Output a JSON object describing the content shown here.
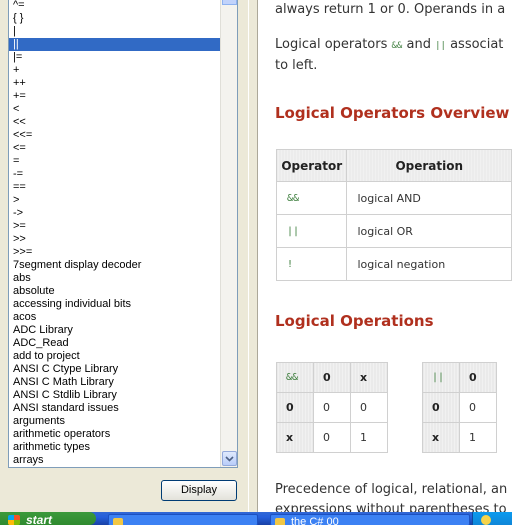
{
  "index": {
    "items": [
      "^=",
      "{ }",
      "|",
      "||",
      "|=",
      "+",
      "++",
      "+=",
      "<",
      "<<",
      "<<=",
      "<=",
      "=",
      "-=",
      "==",
      ">",
      "->",
      ">=",
      ">>",
      ">>=",
      "7segment display decoder",
      "abs",
      "absolute",
      "accessing individual bits",
      "acos",
      "ADC Library",
      "ADC_Read",
      "add to project",
      "ANSI C Ctype Library",
      "ANSI C Math Library",
      "ANSI C Stdlib Library",
      "ANSI standard issues",
      "arguments",
      "arithmetic operators",
      "arithmetic types",
      "arrays"
    ],
    "selected_index": 3,
    "display_button_label": "Display"
  },
  "content": {
    "intro_line1": "always return 1 or 0. Operands in a",
    "intro2_prefix": "Logical operators",
    "intro2_and": "&&",
    "intro2_mid": "and",
    "intro2_or": "||",
    "intro2_suffix": "associat",
    "intro2_line2": "to left.",
    "overview_heading": "Logical Operators Overview",
    "overview_table": {
      "headers": [
        "Operator",
        "Operation"
      ],
      "rows": [
        {
          "operator": "&&",
          "operation": "logical AND"
        },
        {
          "operator": "||",
          "operation": "logical OR"
        },
        {
          "operator": "!",
          "operation": "logical negation"
        }
      ]
    },
    "operations_heading": "Logical Operations",
    "truth_and": {
      "op": "&&",
      "col_headers": [
        "0",
        "x"
      ],
      "rows": [
        {
          "label": "0",
          "cells": [
            "0",
            "0"
          ]
        },
        {
          "label": "x",
          "cells": [
            "0",
            "1"
          ]
        }
      ]
    },
    "truth_or": {
      "op": "||",
      "col_headers": [
        "0"
      ],
      "rows": [
        {
          "label": "0",
          "cells": [
            "0"
          ]
        },
        {
          "label": "x",
          "cells": [
            "1"
          ]
        }
      ]
    },
    "precedence_line1": "Precedence of logical, relational, an",
    "precedence_line2": "expressions without parentheses to"
  },
  "taskbar": {
    "start_label": "start",
    "tasks": [
      "",
      "the C# 00"
    ]
  },
  "colors": {
    "heading": "#b0301e",
    "code": "#3f7f3f",
    "selection": "#316ac5",
    "taskbar": "#245edb",
    "start": "#2f8a2f"
  }
}
